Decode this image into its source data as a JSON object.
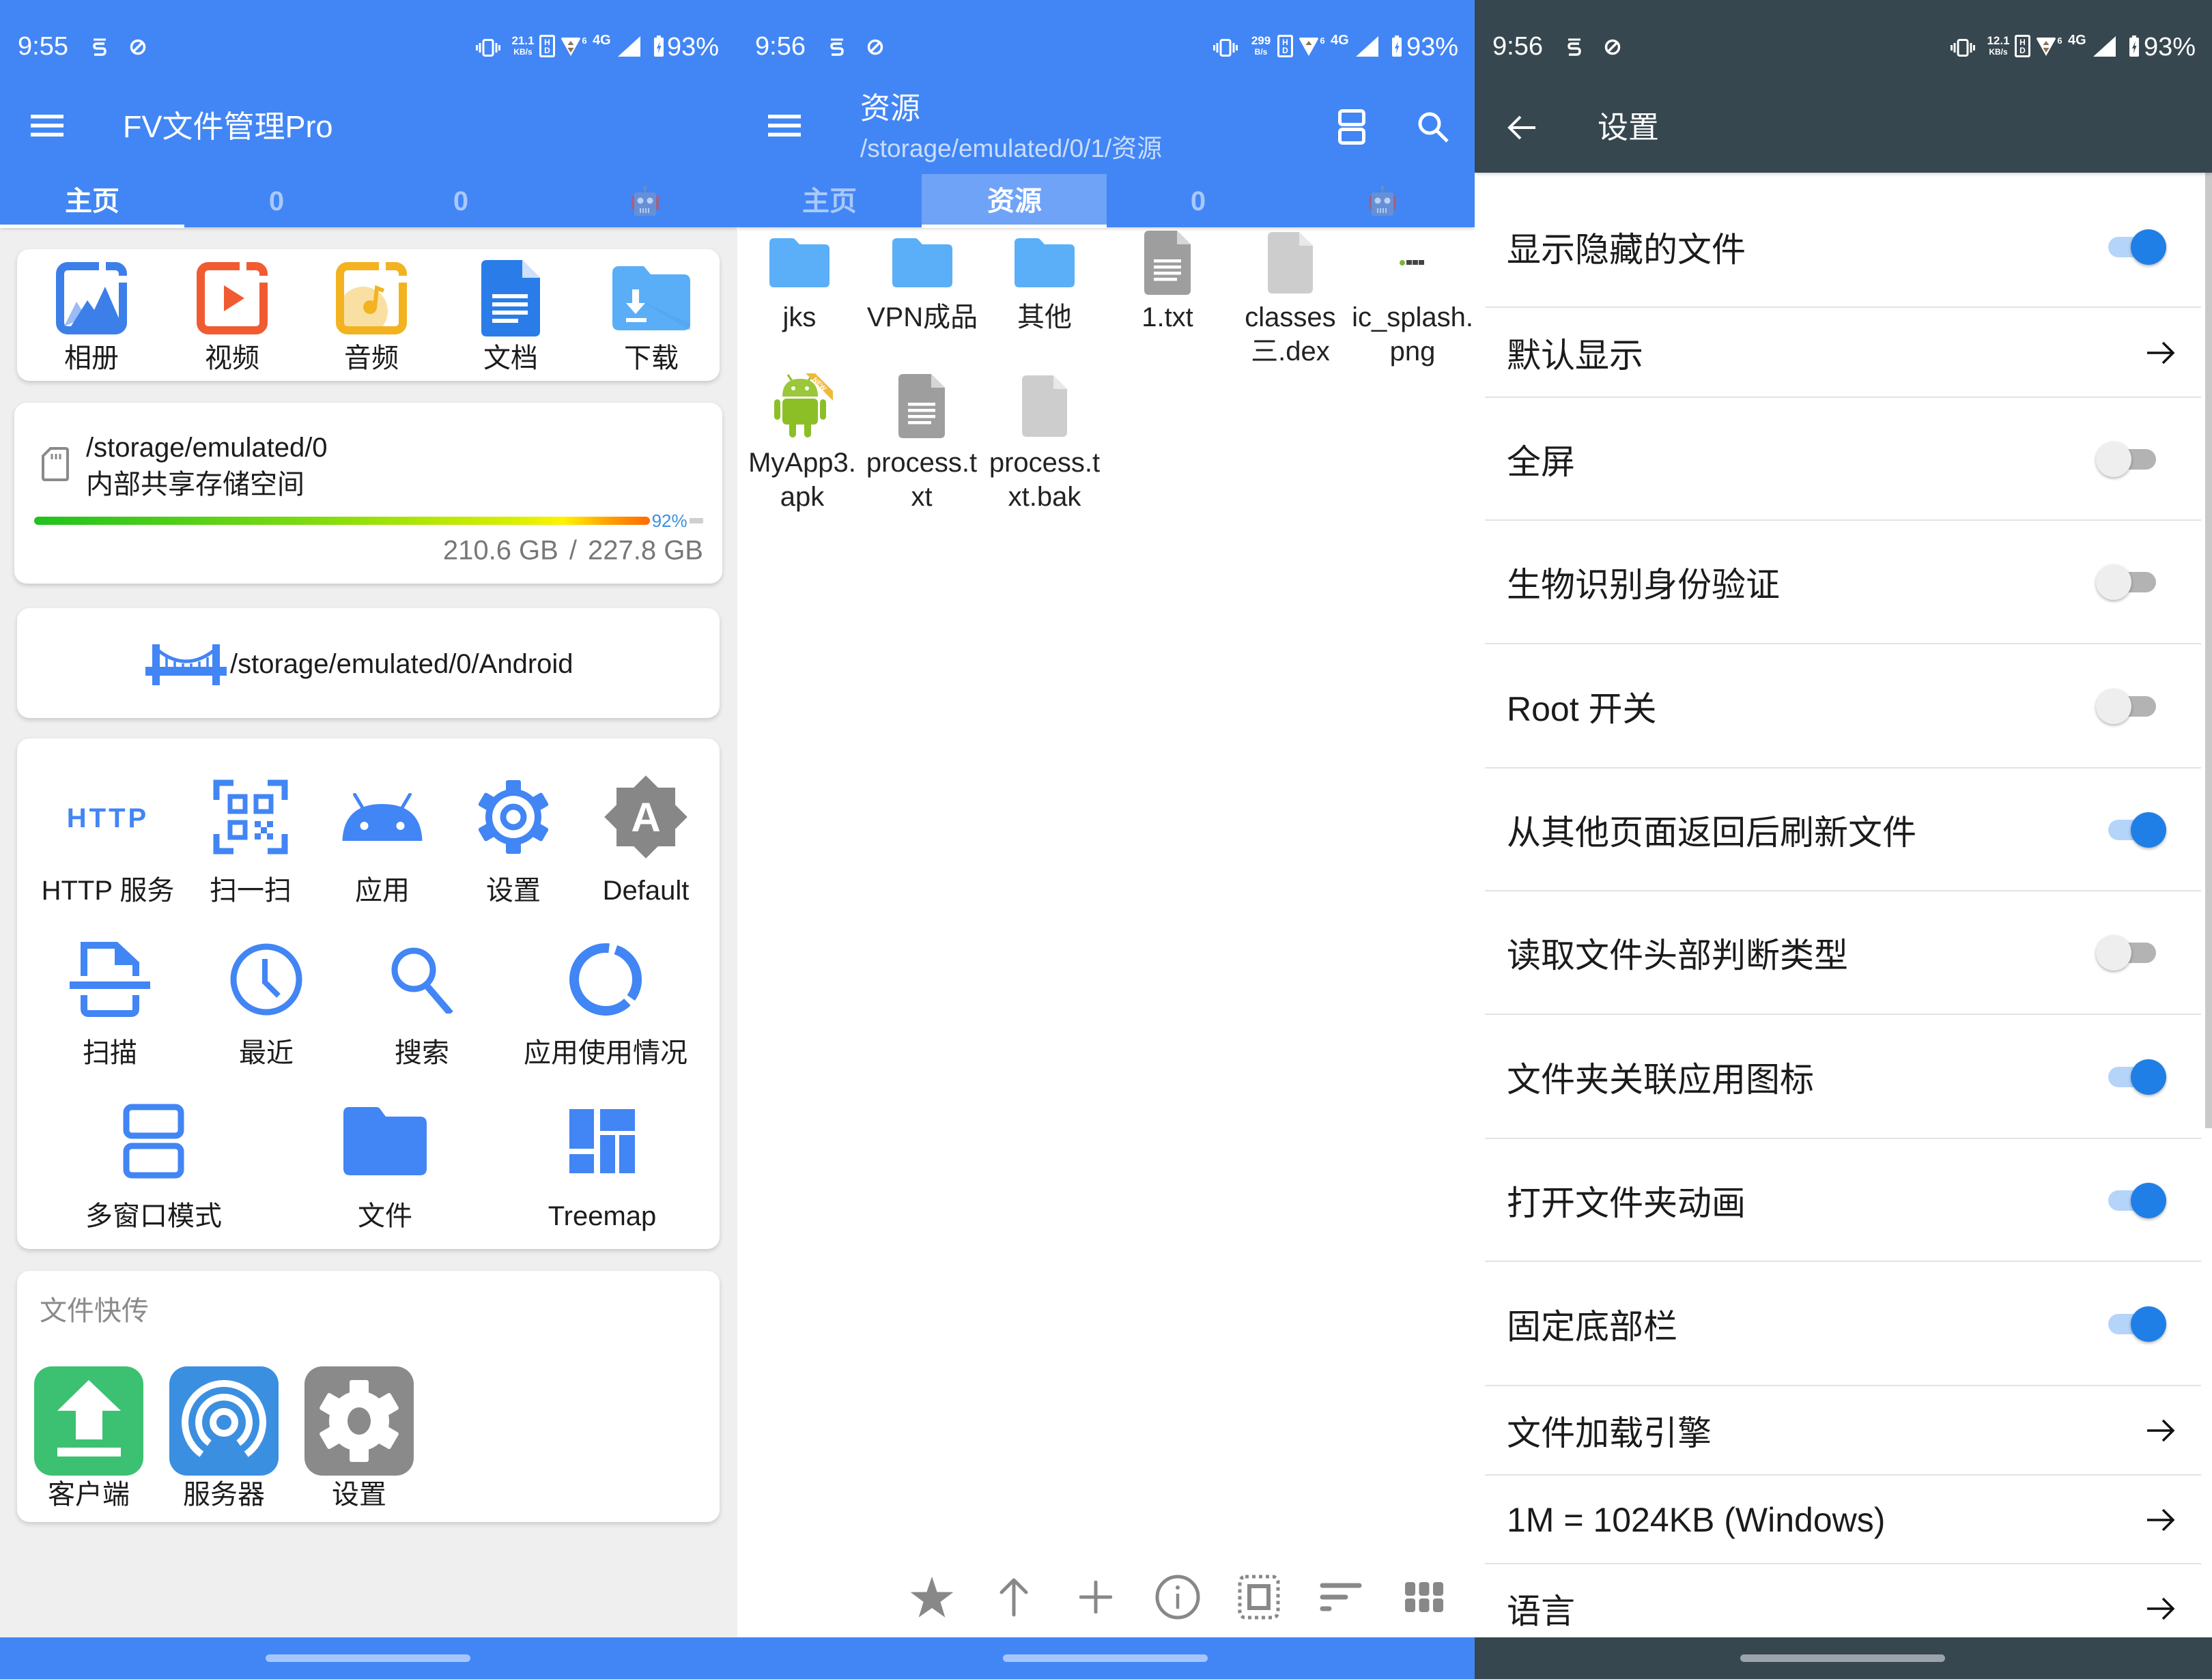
{
  "colors": {
    "primary": "#4286f5",
    "primary_light_tab": "#6fa3f7",
    "settings_bar": "#37474f",
    "page_background": "#efefef",
    "icon_blue": "#4285f4",
    "toggle_on_thumb": "#1f7fe6",
    "toggle_on_track": "#b5d4fa",
    "toggle_off_thumb": "#eeeeee",
    "toggle_off_track": "#b3b3b3",
    "storage_percent": "#3d8fd9",
    "secondary_text": "#777777",
    "toolbar_icon_gray": "#888888"
  },
  "home": {
    "status_bar": {
      "time": "9:55",
      "speed_value": "21.1",
      "speed_unit": "KB/s",
      "hd_top": "H",
      "hd_bottom": "D",
      "data_badge": "6",
      "network": "4G",
      "battery": "93%"
    },
    "toolbar": {
      "title": "FV文件管理Pro",
      "menu_icon": "menu-icon"
    },
    "tabs": [
      {
        "label": "主页",
        "active": true
      },
      {
        "label": "0"
      },
      {
        "label": "0"
      },
      {
        "icon": "robot-icon"
      }
    ],
    "categories": [
      {
        "label": "相册",
        "icon": "gallery-icon"
      },
      {
        "label": "视频",
        "icon": "video-icon"
      },
      {
        "label": "音频",
        "icon": "audio-icon"
      },
      {
        "label": "文档",
        "icon": "document-icon"
      },
      {
        "label": "下载",
        "icon": "download-folder-icon"
      }
    ],
    "storage": {
      "icon": "sd-card-icon",
      "path": "/storage/emulated/0",
      "name": "内部共享存储空间",
      "used_percent": 92,
      "percent_label": "92%",
      "used": "210.6 GB",
      "separator": "/",
      "total": "227.8 GB"
    },
    "bookmark": {
      "icon": "bridge-icon",
      "path": "/storage/emulated/0/Android"
    },
    "tools": [
      {
        "label": "HTTP 服务",
        "icon": "http-icon",
        "icon_text": "HTTP"
      },
      {
        "label": "扫一扫",
        "icon": "qr-scan-icon"
      },
      {
        "label": "应用",
        "icon": "android-icon"
      },
      {
        "label": "设置",
        "icon": "gear-icon"
      },
      {
        "label": "Default",
        "icon": "theme-badge-icon",
        "icon_text": "A"
      },
      {
        "label": "扫描",
        "icon": "document-scanner-icon"
      },
      {
        "label": "最近",
        "icon": "clock-icon"
      },
      {
        "label": "搜索",
        "icon": "search-icon"
      },
      {
        "label": "应用使用情况",
        "icon": "donut-chart-icon"
      },
      {
        "label": "多窗口模式",
        "icon": "multi-window-icon"
      },
      {
        "label": "文件",
        "icon": "folder-icon"
      },
      {
        "label": "Treemap",
        "icon": "treemap-icon"
      }
    ],
    "quick_transfer": {
      "title": "文件快传",
      "items": [
        {
          "label": "客户端",
          "icon": "upload-icon",
          "color": "#3cc172"
        },
        {
          "label": "服务器",
          "icon": "broadcast-icon",
          "color": "#3b8fe0"
        },
        {
          "label": "设置",
          "icon": "gear-icon",
          "color": "#8a8a8a"
        }
      ]
    }
  },
  "explorer": {
    "status_bar": {
      "time": "9:56",
      "speed_value": "299",
      "speed_unit": "B/s",
      "hd_top": "H",
      "hd_bottom": "D",
      "data_badge": "6",
      "network": "4G",
      "battery": "93%"
    },
    "toolbar": {
      "title": "资源",
      "subtitle": "/storage/emulated/0/1/资源",
      "actions": [
        {
          "icon": "split-view-icon"
        },
        {
          "icon": "search-icon"
        }
      ]
    },
    "tabs": [
      {
        "label": "主页"
      },
      {
        "label": "资源",
        "active": true
      },
      {
        "label": "0"
      },
      {
        "icon": "robot-icon"
      }
    ],
    "files": [
      {
        "name": "jks",
        "type": "folder",
        "lines": [
          "jks"
        ]
      },
      {
        "name": "VPN成品",
        "type": "folder",
        "lines": [
          "VPN成品"
        ]
      },
      {
        "name": "其他",
        "type": "folder",
        "lines": [
          "其他"
        ]
      },
      {
        "name": "1.txt",
        "type": "text",
        "lines": [
          "1.txt"
        ]
      },
      {
        "name": "classes三.dex",
        "type": "file",
        "lines": [
          "classes",
          "三.dex"
        ]
      },
      {
        "name": "ic_splash.png",
        "type": "image",
        "lines": [
          "ic_splash.",
          "png"
        ]
      },
      {
        "name": "MyApp3.apk",
        "type": "apk",
        "badge": "NEW",
        "lines": [
          "MyApp3.",
          "apk"
        ]
      },
      {
        "name": "process.txt",
        "type": "text",
        "lines": [
          "process.t",
          "xt"
        ]
      },
      {
        "name": "process.txt.bak",
        "type": "file",
        "lines": [
          "process.t",
          "xt.bak"
        ]
      }
    ],
    "bottom_toolbar": [
      {
        "icon": "star-icon"
      },
      {
        "icon": "arrow-up-icon"
      },
      {
        "icon": "add-icon"
      },
      {
        "icon": "info-icon"
      },
      {
        "icon": "select-all-icon"
      },
      {
        "icon": "sort-icon"
      },
      {
        "icon": "grid-view-icon"
      }
    ]
  },
  "settings": {
    "status_bar": {
      "time": "9:56",
      "speed_value": "12.1",
      "speed_unit": "KB/s",
      "hd_top": "H",
      "hd_bottom": "D",
      "data_badge": "6",
      "network": "4G",
      "battery": "93%"
    },
    "toolbar": {
      "title": "设置",
      "back_icon": "back-arrow-icon"
    },
    "items": [
      {
        "label": "显示隐藏的文件",
        "type": "toggle",
        "checked": true
      },
      {
        "label": "默认显示",
        "type": "link"
      },
      {
        "label": "全屏",
        "type": "toggle",
        "checked": false
      },
      {
        "label": "生物识别身份验证",
        "type": "toggle",
        "checked": false
      },
      {
        "label": "Root 开关",
        "type": "toggle",
        "checked": false
      },
      {
        "label": "从其他页面返回后刷新文件",
        "type": "toggle",
        "checked": true
      },
      {
        "label": "读取文件头部判断类型",
        "type": "toggle",
        "checked": false
      },
      {
        "label": "文件夹关联应用图标",
        "type": "toggle",
        "checked": true
      },
      {
        "label": "打开文件夹动画",
        "type": "toggle",
        "checked": true
      },
      {
        "label": "固定底部栏",
        "type": "toggle",
        "checked": true
      },
      {
        "label": "文件加载引擎",
        "type": "link"
      },
      {
        "label": "1M = 1024KB (Windows)",
        "type": "link"
      },
      {
        "label": "语言",
        "type": "link"
      }
    ]
  }
}
